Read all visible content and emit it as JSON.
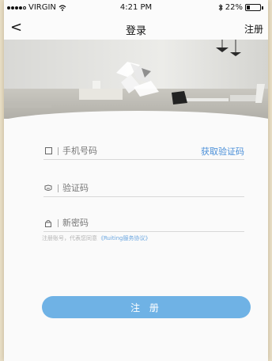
{
  "status_bar": {
    "carrier": "VIRGIN",
    "time": "4:21 PM",
    "battery_percent": "22%",
    "battery_level": 0.22
  },
  "nav": {
    "back_glyph": "<",
    "title": "登录",
    "action": "注册"
  },
  "form": {
    "phone_placeholder": "手机号码",
    "get_code_label": "获取验证码",
    "code_placeholder": "验证码",
    "password_placeholder": "新密码"
  },
  "agreement": {
    "text": "注册账号，代表您同意",
    "link": "《Ruiting服务协议》"
  },
  "register_button": "注 册",
  "icons": {
    "phone": "phone-icon",
    "code": "shield-icon",
    "password": "lock-icon",
    "logo": "app-logo"
  },
  "colors": {
    "accent": "#6fb2e5",
    "link": "#4a8fd8"
  }
}
